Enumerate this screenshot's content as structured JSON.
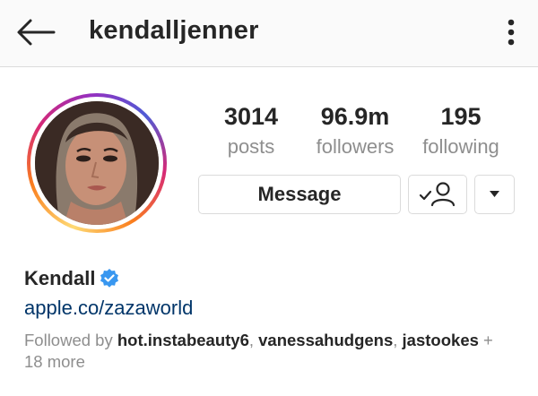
{
  "header": {
    "username": "kendalljenner",
    "back_icon": "arrow-left-icon",
    "more_icon": "vertical-dots-icon"
  },
  "profile": {
    "avatar": "profile-photo",
    "story_ring_colors": [
      "#feda75",
      "#fa7e1e",
      "#d62976",
      "#962fbf",
      "#4f5bd5"
    ]
  },
  "stats": {
    "posts": {
      "value": "3014",
      "label": "posts"
    },
    "followers": {
      "value": "96.9m",
      "label": "followers"
    },
    "following": {
      "value": "195",
      "label": "following"
    }
  },
  "actions": {
    "message_label": "Message",
    "follow_icon": "person-check-icon",
    "dropdown_icon": "caret-down-icon"
  },
  "bio": {
    "name": "Kendall",
    "verified_icon": "verified-badge-icon",
    "verified_color": "#3897f0",
    "link": "apple.co/zazaworld",
    "link_color": "#003569"
  },
  "followed_by": {
    "prefix": "Followed by",
    "users": [
      "hot.instabeauty6",
      "vanessahudgens",
      "jastookes"
    ],
    "sep1": ",",
    "sep2": ",",
    "more": "+ 18 more"
  }
}
